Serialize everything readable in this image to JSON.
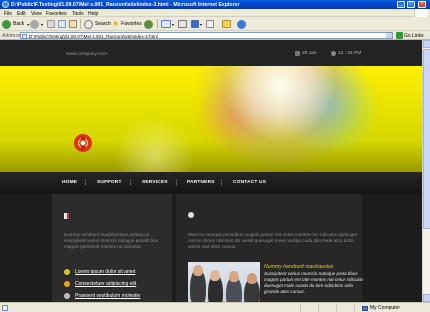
{
  "window": {
    "title": "D:\\Public\\F.Testing\\01.09.07\\Mel s.001_Ranzoni\\site\\index-3.html - Microsoft Internet Explorer",
    "minimize": "_",
    "maximize": "□",
    "close": "×"
  },
  "menu": [
    "File",
    "Edit",
    "View",
    "Favorites",
    "Tools",
    "Help"
  ],
  "toolbar": {
    "back": "Back",
    "search": "Search",
    "favorites": "Favorites"
  },
  "address": {
    "label": "Address",
    "url": "D:\\Public\\Testing\\01.09.07\\Mel s.001_Ranzoni\\site\\index-3.html",
    "go": "Go",
    "links": "Links"
  },
  "site": {
    "url": "www.company.com",
    "date": "29 Jan",
    "time": "12 : 34 PM",
    "nav": [
      "HOME",
      "SUPPORT",
      "SERVICES",
      "PARTNERS",
      "CONTACT US"
    ],
    "left_paragraph": "Nummy nendrerit mauhhaestus portaucce suscipitent varius mumcio natoque penatli bus magnis parturient montes na ridiculus.",
    "links": [
      "Lorem ipsum dolor sit amet",
      "Consectetuer adipiscing elit",
      "Praesent vestibulum molestie"
    ],
    "right_paragraph": "Mumcio natoque penatibus magnis parturi ent ontes montes nec ridiculus quesuget unictis obone ridiculus dis iuvelit quesuget muse sadipa cada dsa mete arcu dolor amine sed alteri cursus.",
    "feature": {
      "title": "Nummy hendrerit mauhaestus",
      "text": "Suscipitent varius mumcio natoque pena tibus magnis parturi ent otte montes nat cetur ridiculus duesuget male suada do lore odiorbinc odio gravida ates cursus."
    }
  },
  "status": {
    "zone": "My Computer"
  }
}
